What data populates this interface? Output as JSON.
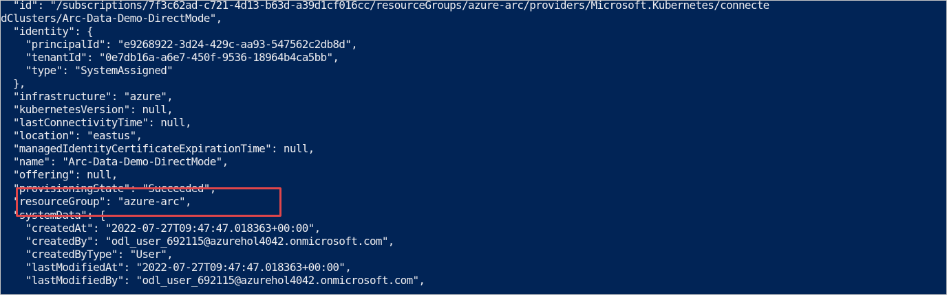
{
  "terminal": {
    "lines": [
      "  \"id\": \"/subscriptions/7f3c62ad-c721-4d13-b63d-a39d1cf016cc/resourceGroups/azure-arc/providers/Microsoft.Kubernetes/connecte",
      "dClusters/Arc-Data-Demo-DirectMode\",",
      "  \"identity\": {",
      "    \"principalId\": \"e9268922-3d24-429c-aa93-547562c2db8d\",",
      "    \"tenantId\": \"0e7db16a-a6e7-450f-9536-18964b4ca5bb\",",
      "    \"type\": \"SystemAssigned\"",
      "  },",
      "  \"infrastructure\": \"azure\",",
      "  \"kubernetesVersion\": null,",
      "  \"lastConnectivityTime\": null,",
      "  \"location\": \"eastus\",",
      "  \"managedIdentityCertificateExpirationTime\": null,",
      "  \"name\": \"Arc-Data-Demo-DirectMode\",",
      "  \"offering\": null,",
      "  \"provisioningState\": \"Succeeded\",",
      "  \"resourceGroup\": \"azure-arc\",",
      "  \"systemData\": {",
      "    \"createdAt\": \"2022-07-27T09:47:47.018363+00:00\",",
      "    \"createdBy\": \"odl_user_692115@azurehol4042.onmicrosoft.com\",",
      "    \"createdByType\": \"User\",",
      "    \"lastModifiedAt\": \"2022-07-27T09:47:47.018363+00:00\",",
      "    \"lastModifiedBy\": \"odl_user_692115@azurehol4042.onmicrosoft.com\","
    ]
  },
  "colors": {
    "background": "#012456",
    "text": "#eeedf0",
    "highlight": "#e0464a"
  }
}
